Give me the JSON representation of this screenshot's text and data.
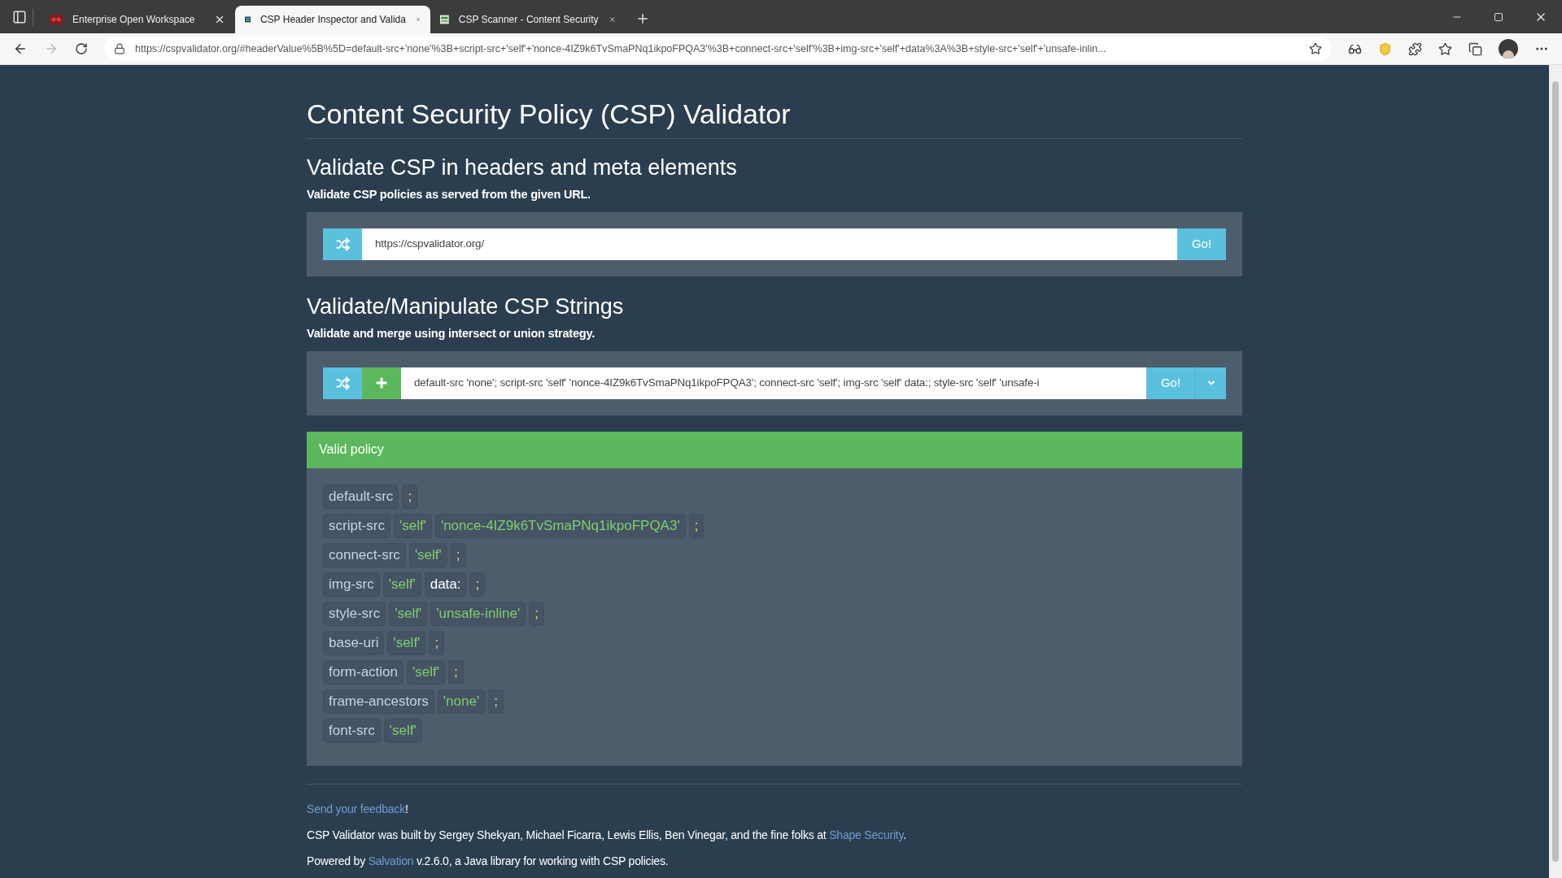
{
  "browser": {
    "tabs": [
      {
        "title": "Enterprise Open Workspace",
        "selected": false
      },
      {
        "title": "CSP Header Inspector and Valida",
        "selected": true
      },
      {
        "title": "CSP Scanner - Content Security",
        "selected": false
      }
    ],
    "address": "https://cspvalidator.org/#headerValue%5B%5D=default-src+'none'%3B+script-src+'self'+'nonce-4IZ9k6TvSmaPNq1ikpoFPQA3'%3B+connect-src+'self'%3B+img-src+'self'+data%3A%3B+style-src+'self'+'unsafe-inlin..."
  },
  "page": {
    "title": "Content Security Policy (CSP) Validator",
    "sections": [
      {
        "heading": "Validate CSP in headers and meta elements",
        "description": "Validate CSP policies as served from the given URL.",
        "controls": [
          {
            "kind": "shuffle"
          },
          {
            "kind": "input",
            "value": "https://cspvalidator.org/"
          },
          {
            "kind": "go",
            "label": "Go!"
          }
        ]
      },
      {
        "heading": "Validate/Manipulate CSP Strings",
        "description": "Validate and merge using intersect or union strategy.",
        "controls": [
          {
            "kind": "shuffle"
          },
          {
            "kind": "add"
          },
          {
            "kind": "input",
            "value": "default-src 'none'; script-src 'self' 'nonce-4IZ9k6TvSmaPNq1ikpoFPQA3'; connect-src 'self'; img-src 'self' data:; style-src 'self' 'unsafe-i"
          },
          {
            "kind": "go",
            "label": "Go!"
          },
          {
            "kind": "dropdown"
          }
        ]
      }
    ],
    "result": {
      "status": "Valid policy",
      "kind": "valid",
      "directives": [
        {
          "tokens": [
            {
              "text": "default-src",
              "kind": "directive"
            },
            {
              "text": ";",
              "kind": "separator"
            }
          ]
        },
        {
          "tokens": [
            {
              "text": "script-src",
              "kind": "directive"
            },
            {
              "text": "'self'",
              "kind": "keyword"
            },
            {
              "text": "'nonce-4IZ9k6TvSmaPNq1ikpoFPQA3'",
              "kind": "keyword"
            },
            {
              "text": ";",
              "kind": "separator"
            }
          ]
        },
        {
          "tokens": [
            {
              "text": "connect-src",
              "kind": "directive"
            },
            {
              "text": "'self'",
              "kind": "keyword"
            },
            {
              "text": ";",
              "kind": "separator"
            }
          ]
        },
        {
          "tokens": [
            {
              "text": "img-src",
              "kind": "directive"
            },
            {
              "text": "'self'",
              "kind": "keyword"
            },
            {
              "text": "data:",
              "kind": "host"
            },
            {
              "text": ";",
              "kind": "separator"
            }
          ]
        },
        {
          "tokens": [
            {
              "text": "style-src",
              "kind": "directive"
            },
            {
              "text": "'self'",
              "kind": "keyword"
            },
            {
              "text": "'unsafe-inline'",
              "kind": "keyword"
            },
            {
              "text": ";",
              "kind": "separator"
            }
          ]
        },
        {
          "tokens": [
            {
              "text": "base-uri",
              "kind": "directive"
            },
            {
              "text": "'self'",
              "kind": "keyword"
            },
            {
              "text": ";",
              "kind": "separator"
            }
          ]
        },
        {
          "tokens": [
            {
              "text": "form-action",
              "kind": "directive"
            },
            {
              "text": "'self'",
              "kind": "keyword"
            },
            {
              "text": ";",
              "kind": "separator"
            }
          ]
        },
        {
          "tokens": [
            {
              "text": "frame-ancestors",
              "kind": "directive"
            },
            {
              "text": "'none'",
              "kind": "keyword"
            },
            {
              "text": ";",
              "kind": "separator"
            }
          ]
        },
        {
          "tokens": [
            {
              "text": "font-src",
              "kind": "directive"
            },
            {
              "text": "'self'",
              "kind": "keyword"
            }
          ]
        }
      ]
    },
    "footer": [
      {
        "link": "Send your feedback",
        "after": "!"
      },
      {
        "before": "CSP Validator was built by Sergey Shekyan, Michael Ficarra, Lewis Ellis, Ben Vinegar, and the fine folks at ",
        "link": "Shape Security",
        "after": "."
      },
      {
        "before": "Powered by ",
        "link": "Salvation",
        "after": " v.2.6.0, a Java library for working with CSP policies."
      }
    ]
  }
}
